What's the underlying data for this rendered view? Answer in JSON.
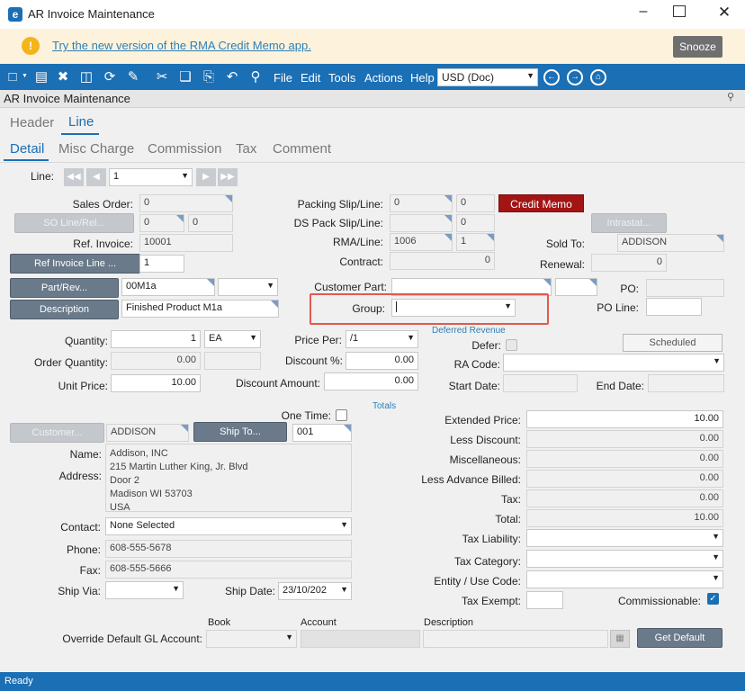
{
  "window": {
    "title": "AR Invoice Maintenance",
    "app_icon": "epicor-e-icon"
  },
  "banner": {
    "text": "Try the new version of the RMA Credit Memo app.",
    "snooze_label": "Snooze"
  },
  "toolbar": {
    "menus": [
      "File",
      "Edit",
      "Tools",
      "Actions",
      "Help"
    ],
    "currency_value": "USD (Doc)"
  },
  "subtitle": "AR Invoice Maintenance",
  "tabs_top": [
    {
      "label": "Header"
    },
    {
      "label": "Line"
    }
  ],
  "tabs_sub": [
    {
      "label": "Detail"
    },
    {
      "label": "Misc Charge"
    },
    {
      "label": "Commission"
    },
    {
      "label": "Tax"
    },
    {
      "label": "Comment"
    }
  ],
  "form": {
    "line_label": "Line:",
    "line_value": "1",
    "sales_order_label": "Sales Order:",
    "sales_order_value": "0",
    "so_line_rel_label": "SO Line/Rel...",
    "so_line_value": "0",
    "so_rel_value": "0",
    "ref_invoice_label": "Ref. Invoice:",
    "ref_invoice_value": "10001",
    "ref_invoice_line_label": "Ref Invoice Line ...",
    "ref_invoice_line_value": "1",
    "part_rev_label": "Part/Rev...",
    "part_value": "00M1a",
    "description_label": "Description",
    "description_value": "Finished Product M1a",
    "packing_slip_label": "Packing Slip/Line:",
    "packing_slip_value": "0",
    "packing_line_value": "0",
    "credit_memo_label": "Credit Memo",
    "ds_pack_label": "DS Pack Slip/Line:",
    "ds_pack_line_value": "0",
    "intrastat_label": "Intrastat...",
    "rma_line_label": "RMA/Line:",
    "rma_value": "1006",
    "rma_line_value": "1",
    "sold_to_label": "Sold To:",
    "sold_to_value": "ADDISON",
    "contract_label": "Contract:",
    "contract_value": "0",
    "renewal_label": "Renewal:",
    "renewal_value": "0",
    "customer_part_label": "Customer Part:",
    "po_label": "PO:",
    "group_label": "Group:",
    "po_line_label": "PO Line:",
    "quantity_label": "Quantity:",
    "quantity_value": "1",
    "uom_value": "EA",
    "order_qty_label": "Order Quantity:",
    "order_qty_value": "0.00",
    "unit_price_label": "Unit Price:",
    "unit_price_value": "10.00",
    "price_per_label": "Price Per:",
    "price_per_value": "/1",
    "discount_pct_label": "Discount %:",
    "discount_pct_value": "0.00",
    "discount_amt_label": "Discount Amount:",
    "discount_amt_value": "0.00",
    "deferred_revenue_label": "Deferred Revenue",
    "defer_label": "Defer:",
    "scheduled_label": "Scheduled",
    "ra_code_label": "RA Code:",
    "start_date_label": "Start Date:",
    "end_date_label": "End Date:",
    "totals_label": "Totals",
    "one_time_label": "One Time:",
    "customer_btn_label": "Customer...",
    "customer_value": "ADDISON",
    "ship_to_label": "Ship To...",
    "ship_to_value": "001",
    "name_label": "Name:",
    "address_label": "Address:",
    "address_lines": [
      "Addison, INC",
      "215 Martin Luther King, Jr. Blvd",
      "Door 2",
      "Madison WI 53703",
      "USA"
    ],
    "contact_label": "Contact:",
    "contact_value": "None Selected",
    "phone_label": "Phone:",
    "phone_value": "608-555-5678",
    "fax_label": "Fax:",
    "fax_value": "608-555-5666",
    "ship_via_label": "Ship Via:",
    "ship_date_label": "Ship Date:",
    "ship_date_value": "23/10/202",
    "extended_price_label": "Extended Price:",
    "extended_price_value": "10.00",
    "less_discount_label": "Less Discount:",
    "less_discount_value": "0.00",
    "misc_label": "Miscellaneous:",
    "misc_value": "0.00",
    "less_adv_label": "Less Advance Billed:",
    "less_adv_value": "0.00",
    "tax_label": "Tax:",
    "tax_value": "0.00",
    "total_label": "Total:",
    "total_value": "10.00",
    "tax_liability_label": "Tax Liability:",
    "tax_category_label": "Tax Category:",
    "entity_use_label": "Entity / Use Code:",
    "tax_exempt_label": "Tax Exempt:",
    "commissionable_label": "Commissionable:",
    "book_label": "Book",
    "account_label": "Account",
    "gl_desc_label": "Description",
    "override_gl_label": "Override Default GL Account:",
    "get_default_label": "Get Default"
  },
  "status": "Ready",
  "colors": {
    "accent": "#1a6fb5",
    "banner_bg": "#fdf3dc",
    "credit_memo": "#a31515",
    "highlight": "#e05a4e"
  }
}
